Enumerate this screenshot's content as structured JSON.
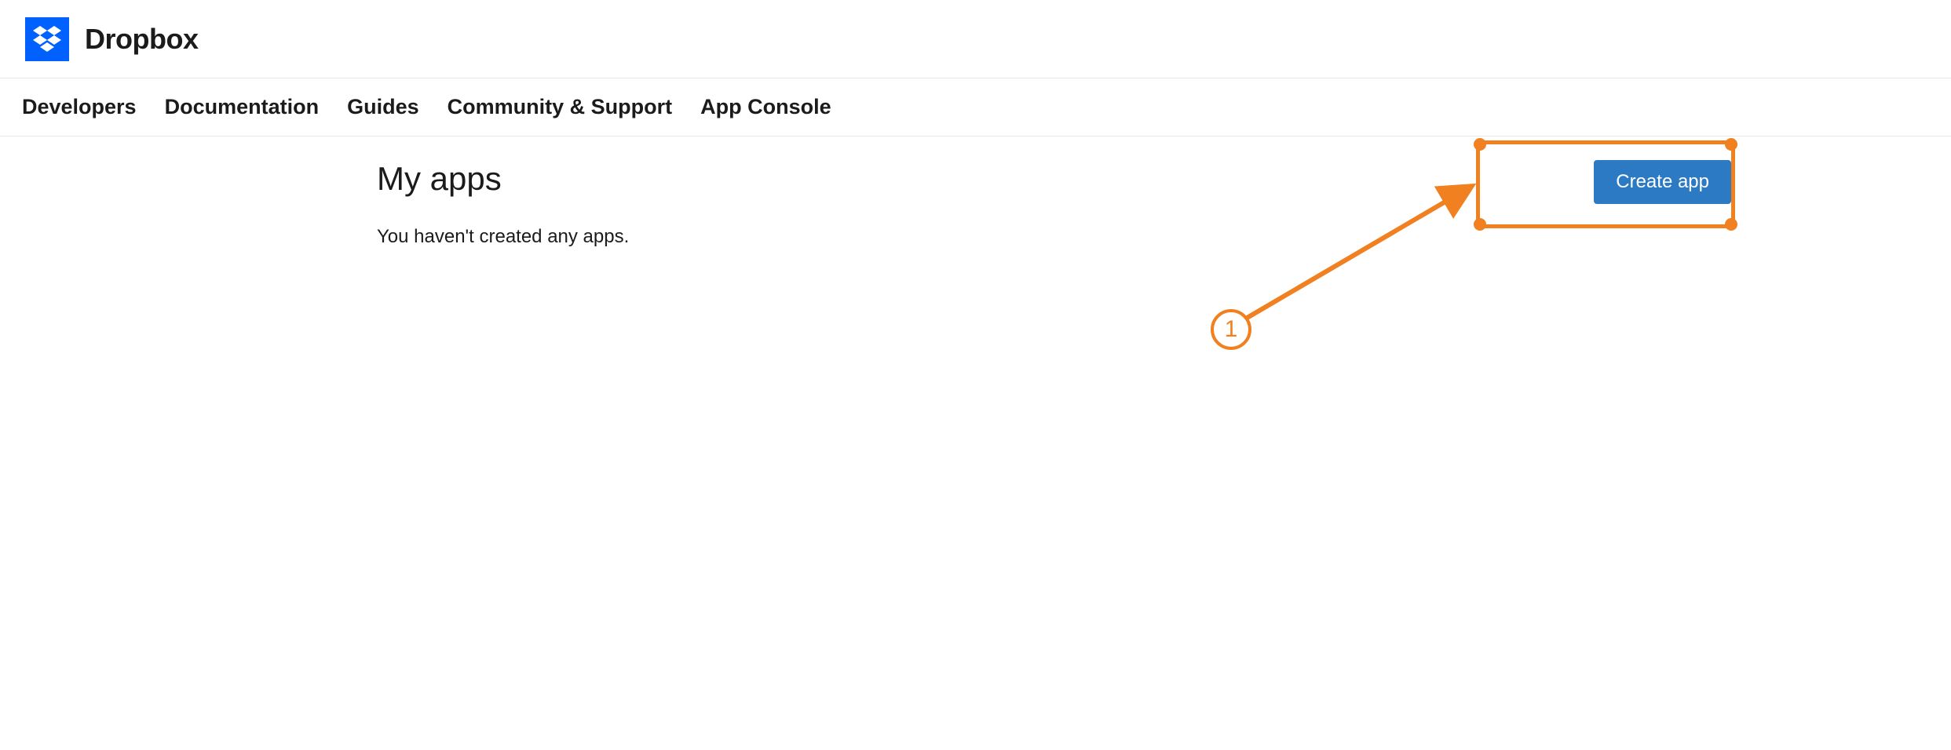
{
  "brand": {
    "name": "Dropbox"
  },
  "nav": {
    "items": [
      {
        "label": "Developers"
      },
      {
        "label": "Documentation"
      },
      {
        "label": "Guides"
      },
      {
        "label": "Community & Support"
      },
      {
        "label": "App Console"
      }
    ]
  },
  "page": {
    "heading": "My apps",
    "empty_message": "You haven't created any apps.",
    "create_button": "Create app"
  },
  "annotation": {
    "number": "1",
    "color": "#f08020"
  }
}
